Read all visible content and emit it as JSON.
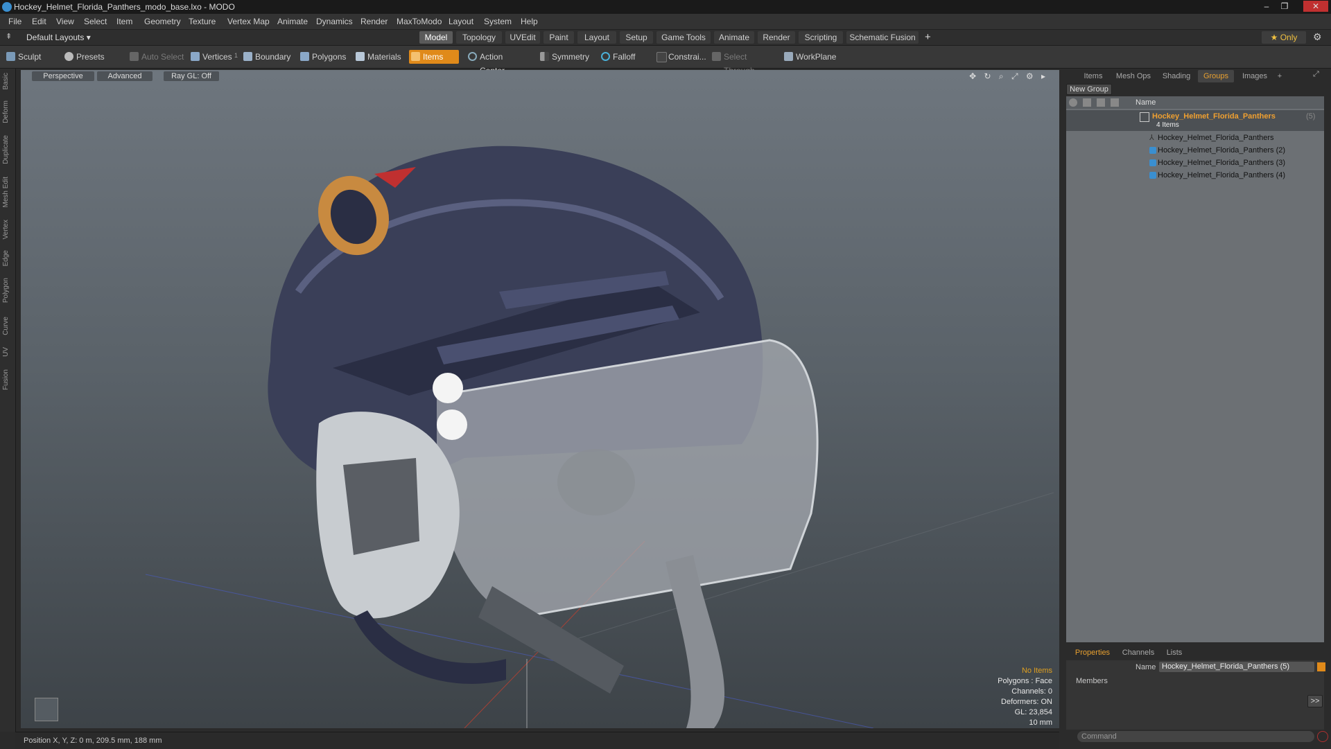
{
  "window": {
    "title": "Hockey_Helmet_Florida_Panthers_modo_base.lxo - MODO",
    "controls": [
      "–",
      "❐",
      "✕"
    ]
  },
  "menu": [
    "File",
    "Edit",
    "View",
    "Select",
    "Item",
    "Geometry",
    "Texture",
    "Vertex Map",
    "Animate",
    "Dynamics",
    "Render",
    "MaxToModo",
    "Layout",
    "System",
    "Help"
  ],
  "layoutbar": {
    "layouts_label": "Default Layouts ▾",
    "tabs": [
      "Model",
      "Topology",
      "UVEdit",
      "Paint",
      "Layout",
      "Setup",
      "Game Tools",
      "Animate",
      "Render",
      "Scripting",
      "Schematic Fusion"
    ],
    "active_tab": "Model",
    "add": "+",
    "only_label": "★ Only"
  },
  "toolbar": {
    "sculpt": "Sculpt",
    "presets": "Presets",
    "auto_select": "Auto Select",
    "vertices": "Vertices",
    "vertices_count": "1",
    "boundary": "Boundary",
    "polygons": "Polygons",
    "materials": "Materials",
    "items": "Items",
    "action_center": "Action Center",
    "symmetry": "Symmetry",
    "falloff": "Falloff",
    "constraints": "Constrai...",
    "select_through": "Select Through",
    "workplane": "WorkPlane"
  },
  "left_tabs": [
    "Basic",
    "Deform",
    "Duplicate",
    "Mesh Edit",
    "Vertex",
    "Edge",
    "Polygon",
    "Curve",
    "UV",
    "Fusion"
  ],
  "viewport": {
    "view_mode": "Perspective",
    "shading": "Advanced",
    "raygl": "Ray GL: Off",
    "hud": {
      "selection": "No Items",
      "polygons": "Polygons : Face",
      "channels": "Channels: 0",
      "deformers": "Deformers: ON",
      "gl": "GL: 23,854",
      "grid": "10 mm"
    }
  },
  "status": {
    "position": "Position X, Y, Z:  0 m, 209.5 mm, 188 mm"
  },
  "right_panel": {
    "tabs": [
      "Items",
      "Mesh Ops",
      "Shading",
      "Groups",
      "Images"
    ],
    "active_tab": "Groups",
    "add": "+",
    "new_group": "New Group",
    "column_name": "Name",
    "group": {
      "name": "Hockey_Helmet_Florida_Panthers",
      "count": "(5)",
      "items_label": "4 Items"
    },
    "items": [
      "Hockey_Helmet_Florida_Panthers",
      "Hockey_Helmet_Florida_Panthers (2)",
      "Hockey_Helmet_Florida_Panthers (3)",
      "Hockey_Helmet_Florida_Panthers (4)"
    ],
    "bottom_tabs": [
      "Properties",
      "Channels",
      "Lists"
    ],
    "bottom_active": "Properties",
    "name_label": "Name",
    "name_value": "Hockey_Helmet_Florida_Panthers (5)",
    "members_label": "Members",
    "expand_btn": ">>",
    "command_placeholder": "Command"
  },
  "colors": {
    "accent": "#e08a1a",
    "group_highlight": "#f0a030",
    "list_bg": "#6c7074"
  }
}
